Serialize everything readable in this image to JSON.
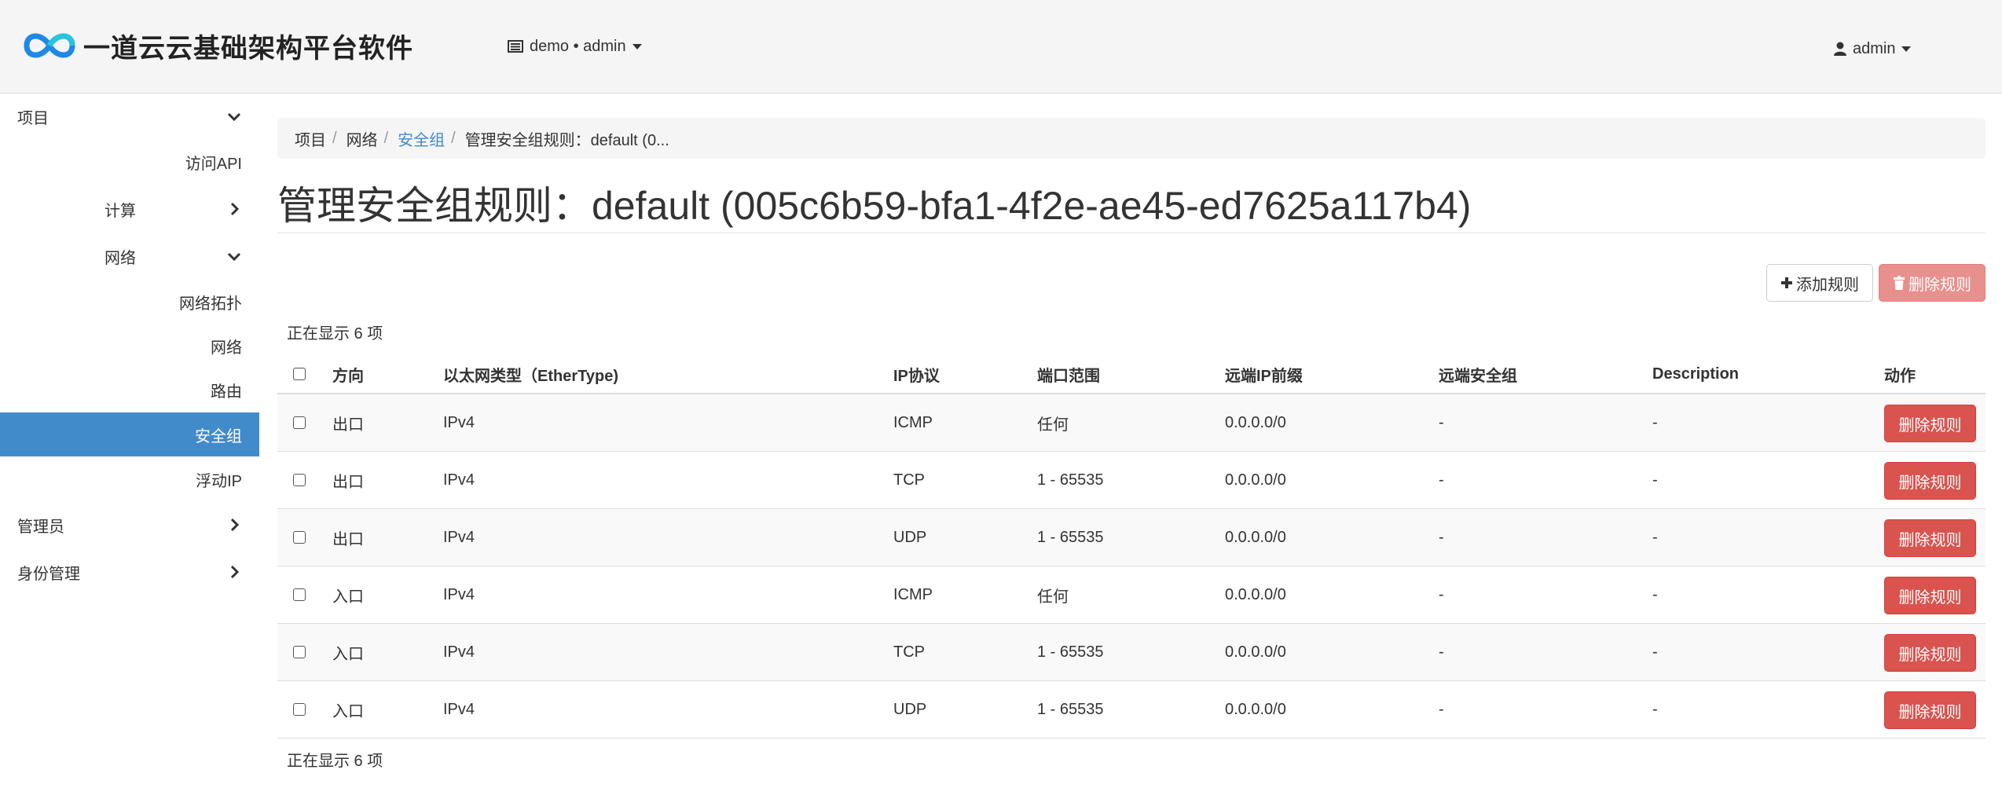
{
  "header": {
    "brand_text": "一道云云基础架构平台软件",
    "project_menu_label": "demo • admin",
    "user_menu_label": "admin"
  },
  "sidebar": {
    "items": [
      {
        "label": "项目",
        "chevron": "down"
      },
      {
        "label": "访问API"
      },
      {
        "label": "计算",
        "chevron": "right"
      },
      {
        "label": "网络",
        "chevron": "down"
      },
      {
        "label": "网络拓扑"
      },
      {
        "label": "网络"
      },
      {
        "label": "路由"
      },
      {
        "label": "安全组",
        "active": true
      },
      {
        "label": "浮动IP"
      },
      {
        "label": "管理员",
        "chevron": "right"
      },
      {
        "label": "身份管理",
        "chevron": "right"
      }
    ]
  },
  "breadcrumb": {
    "items": [
      "项目",
      "网络",
      "安全组",
      "管理安全组规则：default (0..."
    ]
  },
  "page": {
    "title": "管理安全组规则：default (005c6b59-bfa1-4f2e-ae45-ed7625a117b4)"
  },
  "actions": {
    "add_rule": "添加规则",
    "delete_rules": "删除规则"
  },
  "table": {
    "count_top": "正在显示 6 项",
    "count_bottom": "正在显示 6 项",
    "headers": [
      "方向",
      "以太网类型（EtherType)",
      "IP协议",
      "端口范围",
      "远端IP前缀",
      "远端安全组",
      "Description",
      "动作"
    ],
    "rows": [
      {
        "direction": "出口",
        "ethertype": "IPv4",
        "protocol": "ICMP",
        "port_range": "任何",
        "remote_ip": "0.0.0.0/0",
        "remote_group": "-",
        "description": "-",
        "action": "删除规则"
      },
      {
        "direction": "出口",
        "ethertype": "IPv4",
        "protocol": "TCP",
        "port_range": "1 - 65535",
        "remote_ip": "0.0.0.0/0",
        "remote_group": "-",
        "description": "-",
        "action": "删除规则"
      },
      {
        "direction": "出口",
        "ethertype": "IPv4",
        "protocol": "UDP",
        "port_range": "1 - 65535",
        "remote_ip": "0.0.0.0/0",
        "remote_group": "-",
        "description": "-",
        "action": "删除规则"
      },
      {
        "direction": "入口",
        "ethertype": "IPv4",
        "protocol": "ICMP",
        "port_range": "任何",
        "remote_ip": "0.0.0.0/0",
        "remote_group": "-",
        "description": "-",
        "action": "删除规则"
      },
      {
        "direction": "入口",
        "ethertype": "IPv4",
        "protocol": "TCP",
        "port_range": "1 - 65535",
        "remote_ip": "0.0.0.0/0",
        "remote_group": "-",
        "description": "-",
        "action": "删除规则"
      },
      {
        "direction": "入口",
        "ethertype": "IPv4",
        "protocol": "UDP",
        "port_range": "1 - 65535",
        "remote_ip": "0.0.0.0/0",
        "remote_group": "-",
        "description": "-",
        "action": "删除规则"
      }
    ]
  },
  "colors": {
    "accent": "#428bca",
    "danger": "#d9534f",
    "danger_disabled": "#e8908d"
  },
  "icons": {
    "logo": "infinity-logo-icon",
    "project": "project-list-icon",
    "user": "user-icon",
    "add": "plus-icon",
    "delete": "trash-icon"
  }
}
